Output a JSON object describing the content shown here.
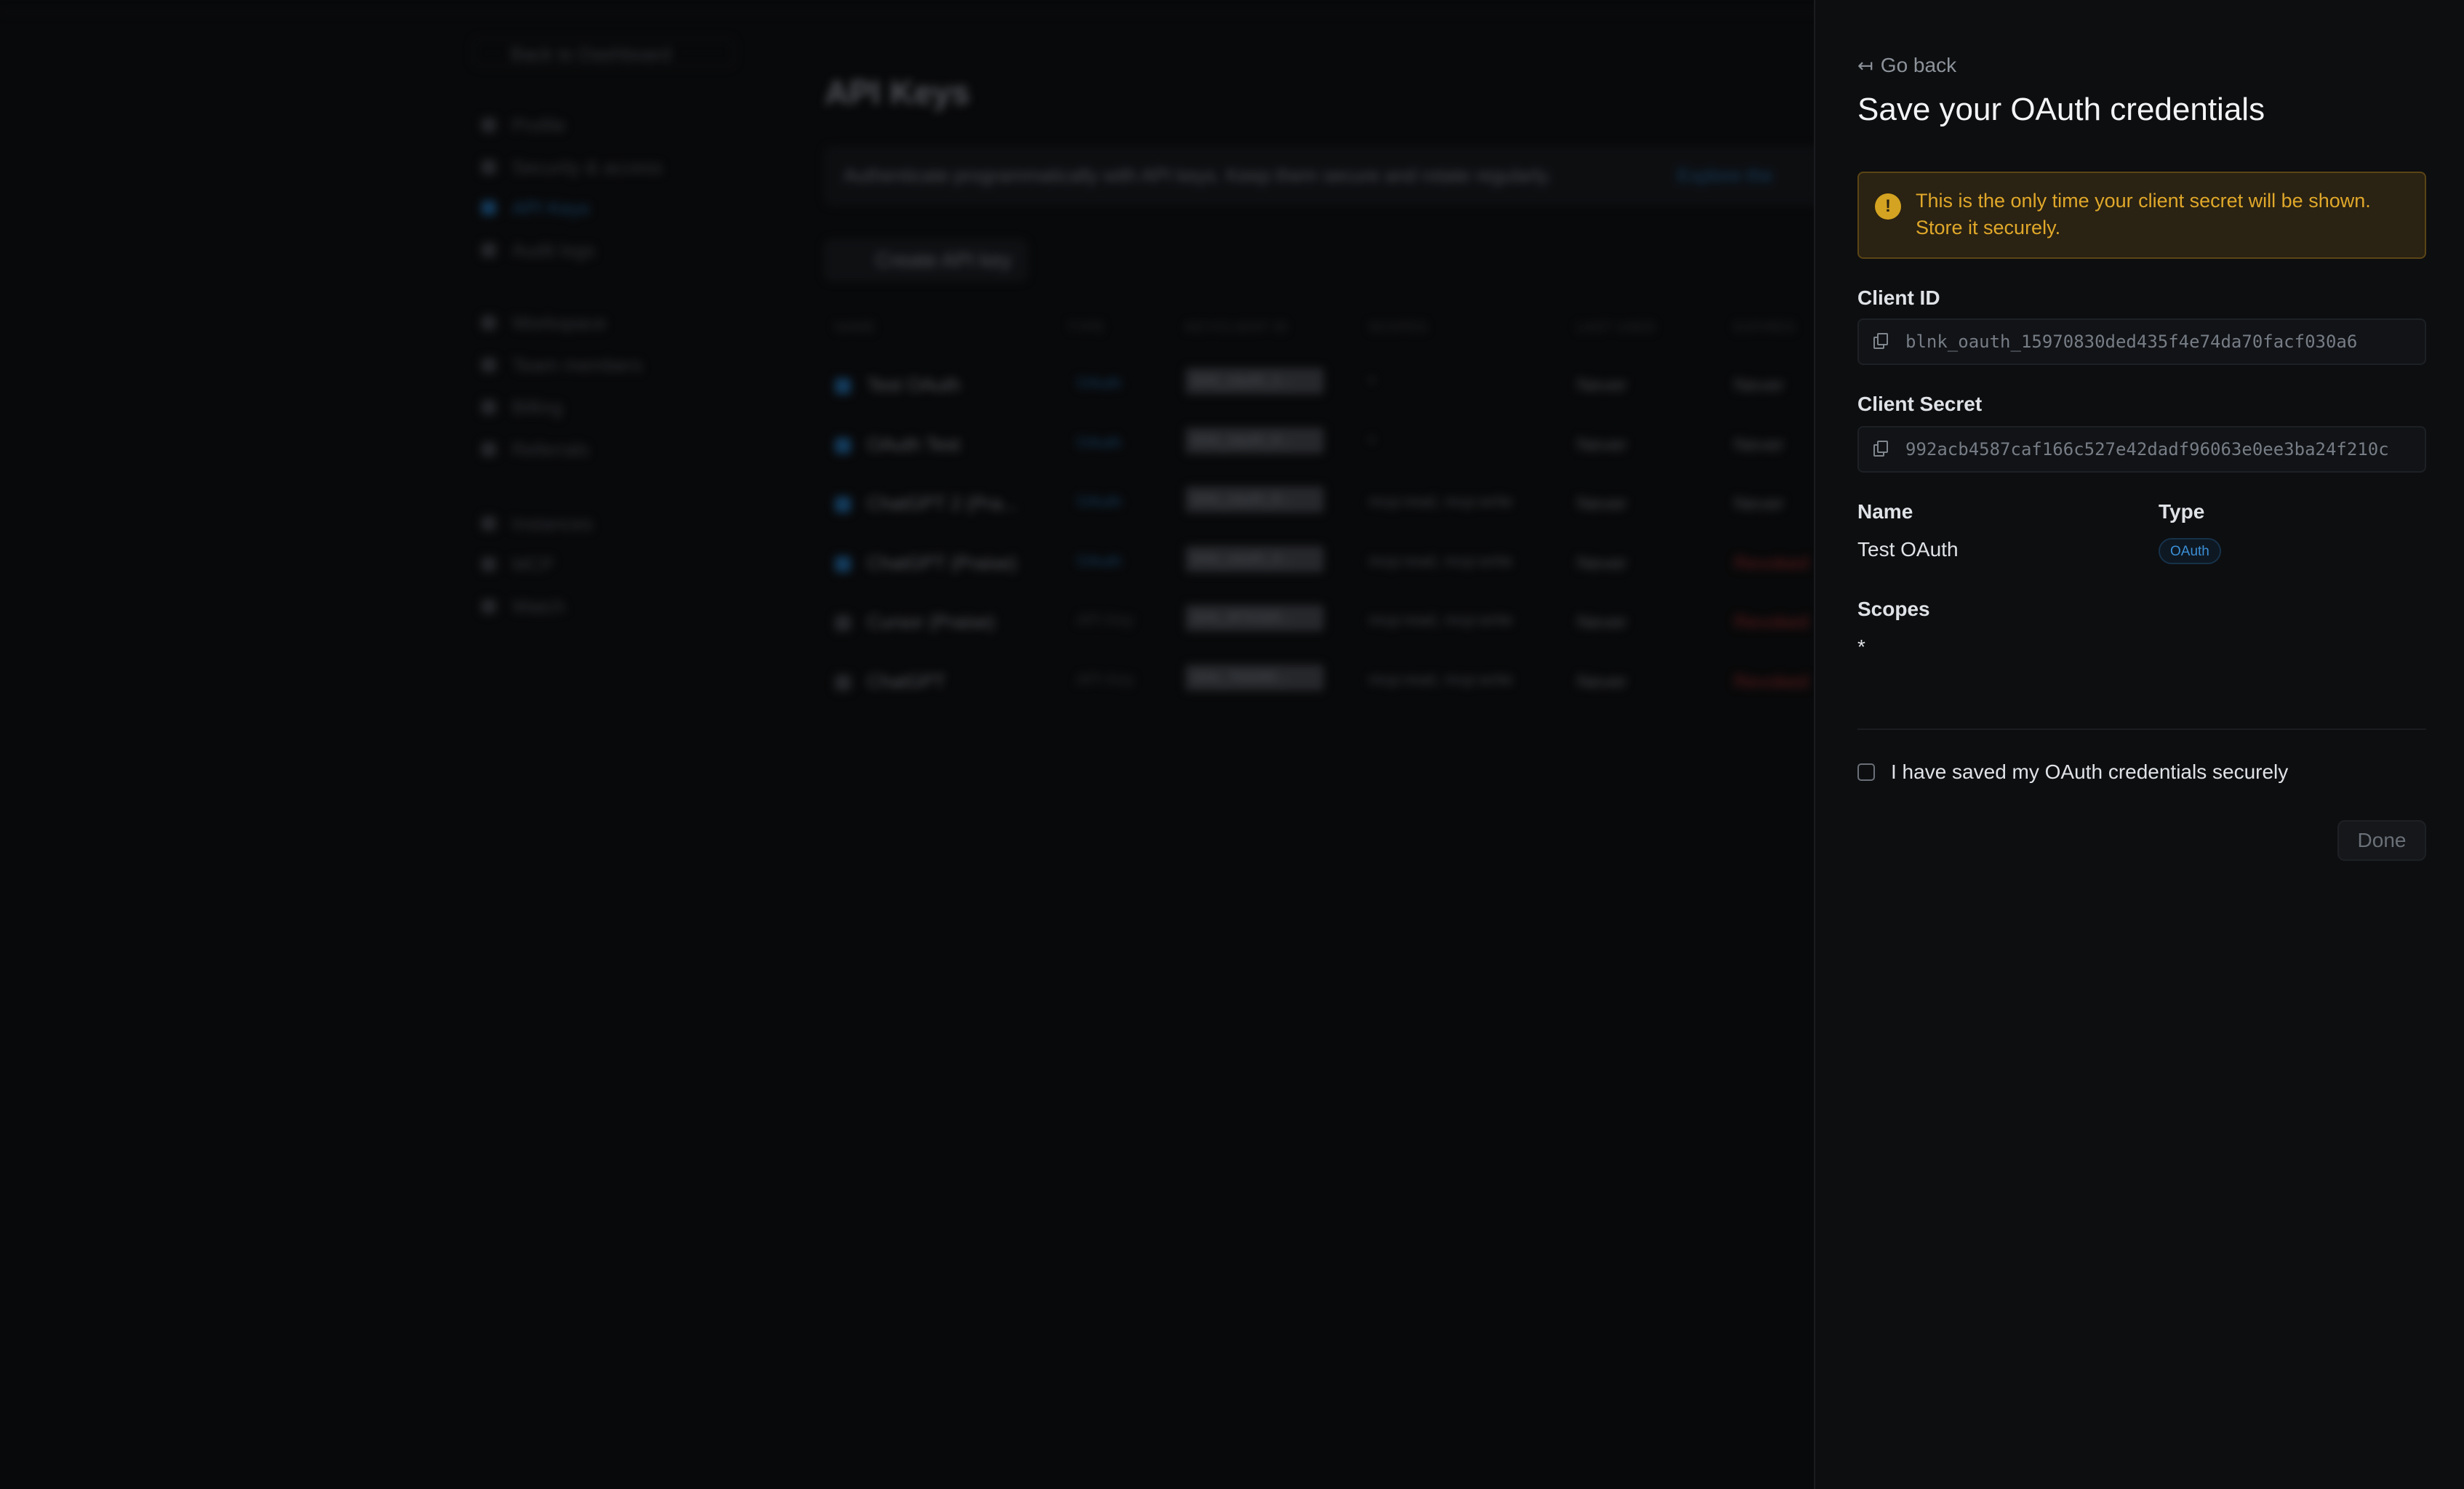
{
  "background": {
    "back_link": "Back to Dashboard",
    "nav": [
      {
        "label": "Profile",
        "active": false
      },
      {
        "label": "Security & access",
        "active": false
      },
      {
        "label": "API Keys",
        "active": true
      },
      {
        "label": "Audit logs",
        "active": false
      },
      {
        "label": "Workspace",
        "active": false
      },
      {
        "label": "Team members",
        "active": false
      },
      {
        "label": "Billing",
        "active": false
      },
      {
        "label": "Referrals",
        "active": false
      },
      {
        "label": "Instances",
        "active": false
      },
      {
        "label": "MCP",
        "active": false
      },
      {
        "label": "Watch",
        "active": false
      }
    ],
    "page_title": "API Keys",
    "banner_text": "Authenticate programmatically with API keys. Keep them secure and rotate regularly.",
    "banner_link": "Explore the",
    "create_button": "Create API key",
    "table": {
      "headers": [
        "NAME",
        "TYPE",
        "KEY/CLIENT ID",
        "SCOPES",
        "LAST USED",
        "EXPIRES"
      ],
      "rows": [
        {
          "name": "Test OAuth",
          "type": "OAuth",
          "id": "blnk_oauth_1...",
          "scopes": "*",
          "last_used": "Never",
          "expires": "Never",
          "revoked": false,
          "oauth": true
        },
        {
          "name": "OAuth Test",
          "type": "OAuth",
          "id": "blnk_oauth_6...",
          "scopes": "*",
          "last_used": "Never",
          "expires": "Never",
          "revoked": false,
          "oauth": true
        },
        {
          "name": "ChatGPT 2 (Pra...",
          "type": "OAuth",
          "id": "blnk_oauth_8...",
          "scopes": "mcp:read, mcp:write",
          "last_used": "Never",
          "expires": "Never",
          "revoked": false,
          "oauth": true
        },
        {
          "name": "ChatGPT (Praise)",
          "type": "OAuth",
          "id": "blnk_oauth_3...",
          "scopes": "mcp:read, mcp:write",
          "last_used": "Never",
          "expires": "Revoked",
          "revoked": true,
          "oauth": true
        },
        {
          "name": "Cursor (Praise)",
          "type": "API Key",
          "id": "blnk_8f7b3d9...",
          "scopes": "mcp:read, mcp:write",
          "last_used": "Never",
          "expires": "Revoked",
          "revoked": true,
          "oauth": false
        },
        {
          "name": "ChatGPT",
          "type": "API Key",
          "id": "blnk_7b8d98...",
          "scopes": "mcp:read, mcp:write",
          "last_used": "Never",
          "expires": "Revoked",
          "revoked": true,
          "oauth": false
        }
      ]
    }
  },
  "panel": {
    "go_back": "Go back",
    "go_back_icon": "↤",
    "title": "Save your OAuth credentials",
    "warning_icon": "!",
    "warning_text": "This is the only time your client secret will be shown. Store it securely.",
    "client_id_label": "Client ID",
    "client_id": "blnk_oauth_15970830ded435f4e74da70facf030a6",
    "client_secret_label": "Client Secret",
    "client_secret": "992acb4587caf166c527e42dadf96063e0ee3ba24f210c",
    "name_label": "Name",
    "name_value": "Test OAuth",
    "type_label": "Type",
    "type_value": "OAuth",
    "scopes_label": "Scopes",
    "scopes_value": "*",
    "confirm_label": "I have saved my OAuth credentials securely",
    "confirm_checked": false,
    "done_button": "Done"
  },
  "colors": {
    "background": "#0d0e10",
    "accent": "#3b8fd6",
    "warning": "#e0a82a",
    "revoked": "#8c2a2a"
  }
}
